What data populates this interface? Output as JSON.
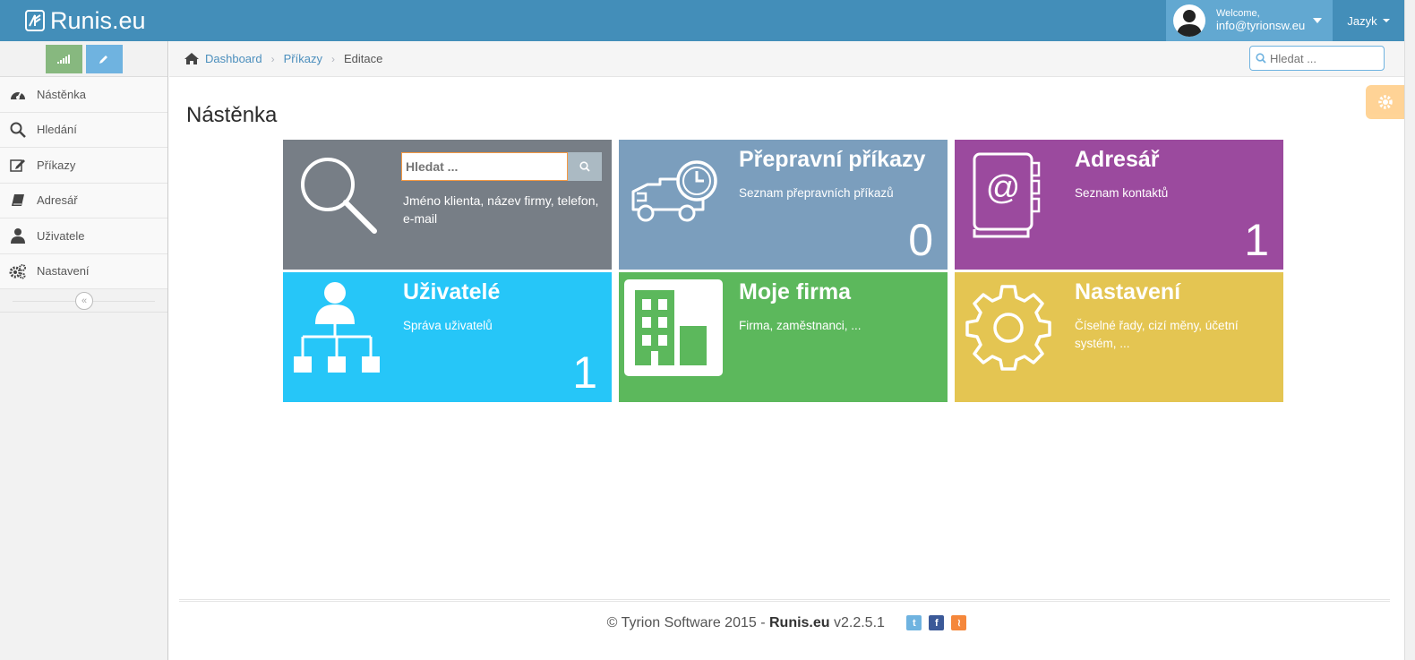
{
  "navbar": {
    "brand": "Runis.eu",
    "welcome": "Welcome,",
    "user_email": "info@tyrionsw.eu",
    "language_label": "Jazyk"
  },
  "sidebar": {
    "items": [
      {
        "label": "Nástěnka",
        "icon": "dashboard-icon"
      },
      {
        "label": "Hledání",
        "icon": "search-icon"
      },
      {
        "label": "Příkazy",
        "icon": "edit-icon"
      },
      {
        "label": "Adresář",
        "icon": "book-icon"
      },
      {
        "label": "Uživatele",
        "icon": "user-icon"
      },
      {
        "label": "Nastavení",
        "icon": "cogs-icon"
      }
    ]
  },
  "breadcrumbs": {
    "home": "Dashboard",
    "level1": "Příkazy",
    "current": "Editace"
  },
  "nav_search": {
    "placeholder": "Hledat ..."
  },
  "page": {
    "title": "Nástěnka"
  },
  "tiles": {
    "search": {
      "placeholder": "Hledat ...",
      "hint": "Jméno klienta, název firmy, telefon, e-mail"
    },
    "orders": {
      "title": "Přepravní příkazy",
      "subtitle": "Seznam přepravních příkazů",
      "count": "0"
    },
    "addressbook": {
      "title": "Adresář",
      "subtitle": "Seznam kontaktů",
      "count": "1"
    },
    "users": {
      "title": "Uživatelé",
      "subtitle": "Správa uživatelů",
      "count": "1"
    },
    "firm": {
      "title": "Moje firma",
      "subtitle": "Firma, zaměstnanci, ..."
    },
    "settings": {
      "title": "Nastavení",
      "subtitle": "Číselné řady, cizí měny, účetní systém, ..."
    }
  },
  "footer": {
    "copyright": "© Tyrion Software 2015 - ",
    "product": "Runis.eu",
    "version": " v2.2.5.1"
  },
  "colors": {
    "navbar": "#438eb9",
    "tile_search": "#777e86",
    "tile_orders": "#7b9ebd",
    "tile_addressbook": "#9b4a9e",
    "tile_users": "#26c6f8",
    "tile_firm": "#5cb85c",
    "tile_settings": "#e4c552"
  }
}
